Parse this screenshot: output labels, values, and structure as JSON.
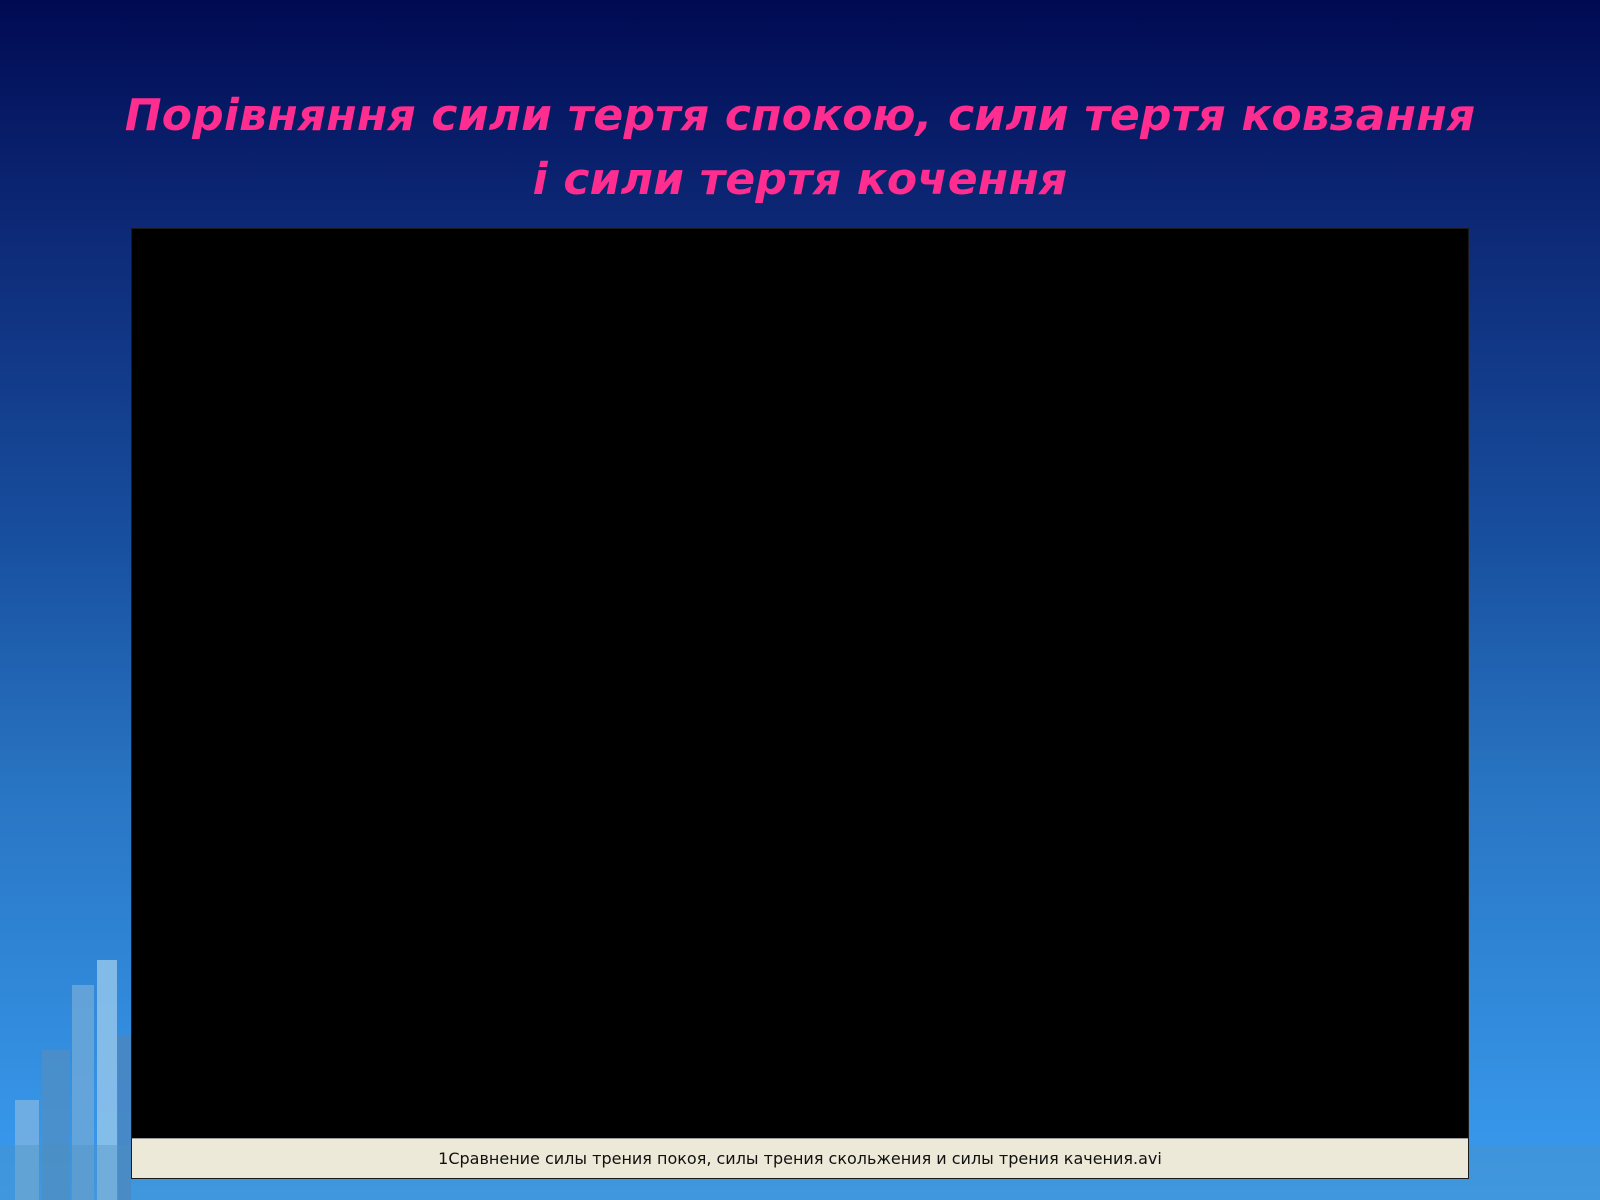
{
  "slide": {
    "title": "Порівняння сили тертя спокою, сили тертя ковзання і сили тертя кочення",
    "title_color": "#ff2d8f"
  },
  "video": {
    "file_name": "1Сравнение силы трения покоя, силы трения скольжения и силы трения качения.avi"
  },
  "background": {
    "top_color": "#000a52",
    "bottom_color": "#3a9cf0"
  }
}
